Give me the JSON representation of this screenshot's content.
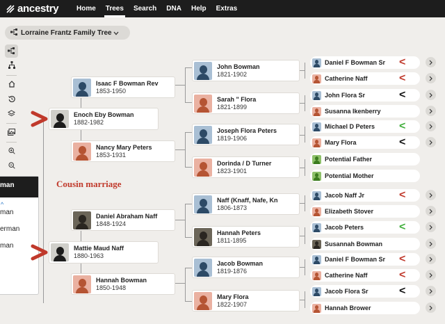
{
  "nav": {
    "logo_text": "ancestry",
    "items": [
      "Home",
      "Trees",
      "Search",
      "DNA",
      "Help",
      "Extras"
    ],
    "active": "Trees"
  },
  "tree_picker": {
    "name": "Lorraine Frantz Family Tree",
    "icon": "family-tree-icon"
  },
  "toolbar": {
    "items": [
      "pedigree-view-icon",
      "descendant-view-icon",
      "home-icon",
      "history-icon",
      "layers-icon",
      "gallery-icon",
      "zoom-in-icon",
      "zoom-out-icon"
    ]
  },
  "left_panel": {
    "header": "man",
    "items": [
      "man",
      "erman",
      "man"
    ]
  },
  "annotation": {
    "text": "Cousin marriage",
    "color": "#c0392b"
  },
  "colors": {
    "red_mark": "#c0392b",
    "green_mark": "#3fae3a",
    "black_mark": "#111111",
    "male_avatar": "#a9bfd4",
    "female_avatar": "#eab1a1"
  },
  "people": {
    "enoch": {
      "name": "Enoch Eby Bowman",
      "years": "1882-1982"
    },
    "isaac": {
      "name": "Isaac F Bowman Rev",
      "years": "1853-1950"
    },
    "nancy": {
      "name": "Nancy Mary Peters",
      "years": "1853-1931"
    },
    "john_b": {
      "name": "John Bowman",
      "years": "1821-1902"
    },
    "sarah": {
      "name": "Sarah \" Flora",
      "years": "1821-1899"
    },
    "joseph": {
      "name": "Joseph Flora Peters",
      "years": "1819-1906"
    },
    "dorinda": {
      "name": "Dorinda / D Turner",
      "years": "1823-1901"
    },
    "mattie": {
      "name": "Mattie Maud Naff",
      "years": "1880-1963"
    },
    "daniel_a": {
      "name": "Daniel Abraham Naff",
      "years": "1848-1924"
    },
    "hannah_b": {
      "name": "Hannah Bowman",
      "years": "1850-1948"
    },
    "naff": {
      "name": "Naff (Knaff, Nafe, Kn",
      "years": "1806-1873"
    },
    "hannah_p": {
      "name": "Hannah Peters",
      "years": "1811-1895"
    },
    "jacob_b": {
      "name": "Jacob Bowman",
      "years": "1819-1876"
    },
    "mary_f": {
      "name": "Mary Flora",
      "years": "1822-1907"
    }
  },
  "gen4": [
    {
      "name": "Daniel F Bowman Sr",
      "mark": "<",
      "mark_color": "red"
    },
    {
      "name": "Catherine Naff",
      "mark": "<",
      "mark_color": "red"
    },
    {
      "name": "John Flora Sr",
      "mark": "<",
      "mark_color": "black"
    },
    {
      "name": "Susanna Ikenberry",
      "mark": "",
      "mark_color": ""
    },
    {
      "name": "Michael D Peters",
      "mark": "<",
      "mark_color": "green"
    },
    {
      "name": "Mary Flora",
      "mark": "<",
      "mark_color": "black"
    },
    {
      "name": "Potential Father",
      "mark": "",
      "mark_color": ""
    },
    {
      "name": "Potential Mother",
      "mark": "",
      "mark_color": ""
    },
    {
      "name": "Jacob Naff Jr",
      "mark": "<",
      "mark_color": "red"
    },
    {
      "name": "Elizabeth Stover",
      "mark": "",
      "mark_color": ""
    },
    {
      "name": "Jacob Peters",
      "mark": "<",
      "mark_color": "green"
    },
    {
      "name": "Susannah Bowman",
      "mark": "",
      "mark_color": ""
    },
    {
      "name": "Daniel F Bowman Sr",
      "mark": "<",
      "mark_color": "red"
    },
    {
      "name": "Catherine Naff",
      "mark": "<",
      "mark_color": "red"
    },
    {
      "name": "Jacob Flora Sr",
      "mark": "<",
      "mark_color": "black"
    },
    {
      "name": "Hannah Brower",
      "mark": "",
      "mark_color": ""
    }
  ]
}
